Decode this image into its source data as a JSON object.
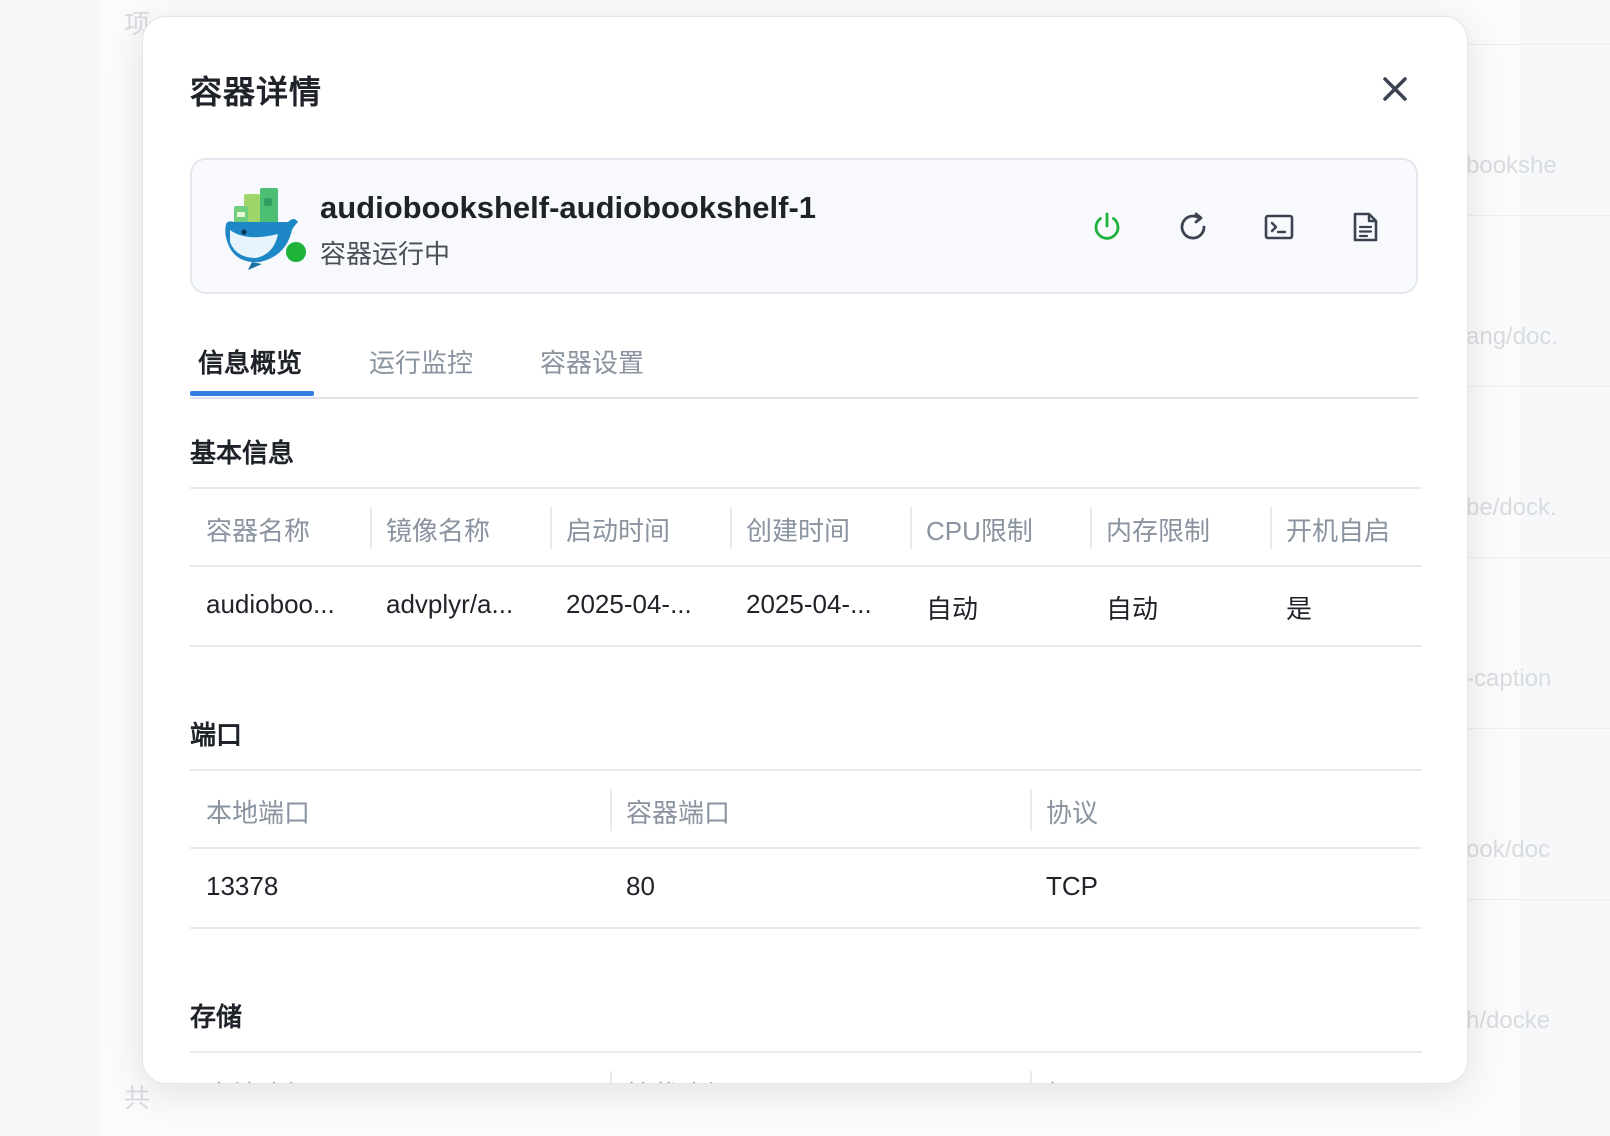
{
  "background": {
    "left_fragments": [
      "项",
      "共"
    ],
    "right_fragments": [
      "bookshe",
      "ang/doc.",
      "be/dock.",
      "-caption",
      "ook/doc",
      "h/docke"
    ]
  },
  "modal": {
    "title": "容器详情"
  },
  "container": {
    "name": "audiobookshelf-audiobookshelf-1",
    "status": "容器运行中",
    "status_color": "#1fb33c",
    "actions": [
      {
        "icon": "power-icon",
        "color": "#1fb33c"
      },
      {
        "icon": "restart-icon",
        "color": "#3b4350"
      },
      {
        "icon": "terminal-icon",
        "color": "#3b4350"
      },
      {
        "icon": "log-file-icon",
        "color": "#3b4350"
      }
    ]
  },
  "tabs": [
    {
      "label": "信息概览",
      "active": true
    },
    {
      "label": "运行监控",
      "active": false
    },
    {
      "label": "容器设置",
      "active": false
    }
  ],
  "basic_info": {
    "title": "基本信息",
    "headers": [
      "容器名称",
      "镜像名称",
      "启动时间",
      "创建时间",
      "CPU限制",
      "内存限制",
      "开机自启"
    ],
    "row": [
      "audioboo...",
      "advplyr/a...",
      "2025-04-...",
      "2025-04-...",
      "自动",
      "自动",
      "是"
    ]
  },
  "ports": {
    "title": "端口",
    "headers": [
      "本地端口",
      "容器端口",
      "协议"
    ],
    "row": [
      "13378",
      "80",
      "TCP"
    ]
  },
  "storage": {
    "title": "存储",
    "headers": [
      "本地路径",
      "挂载路径",
      "权限"
    ]
  },
  "accent_color": "#2f7de1"
}
